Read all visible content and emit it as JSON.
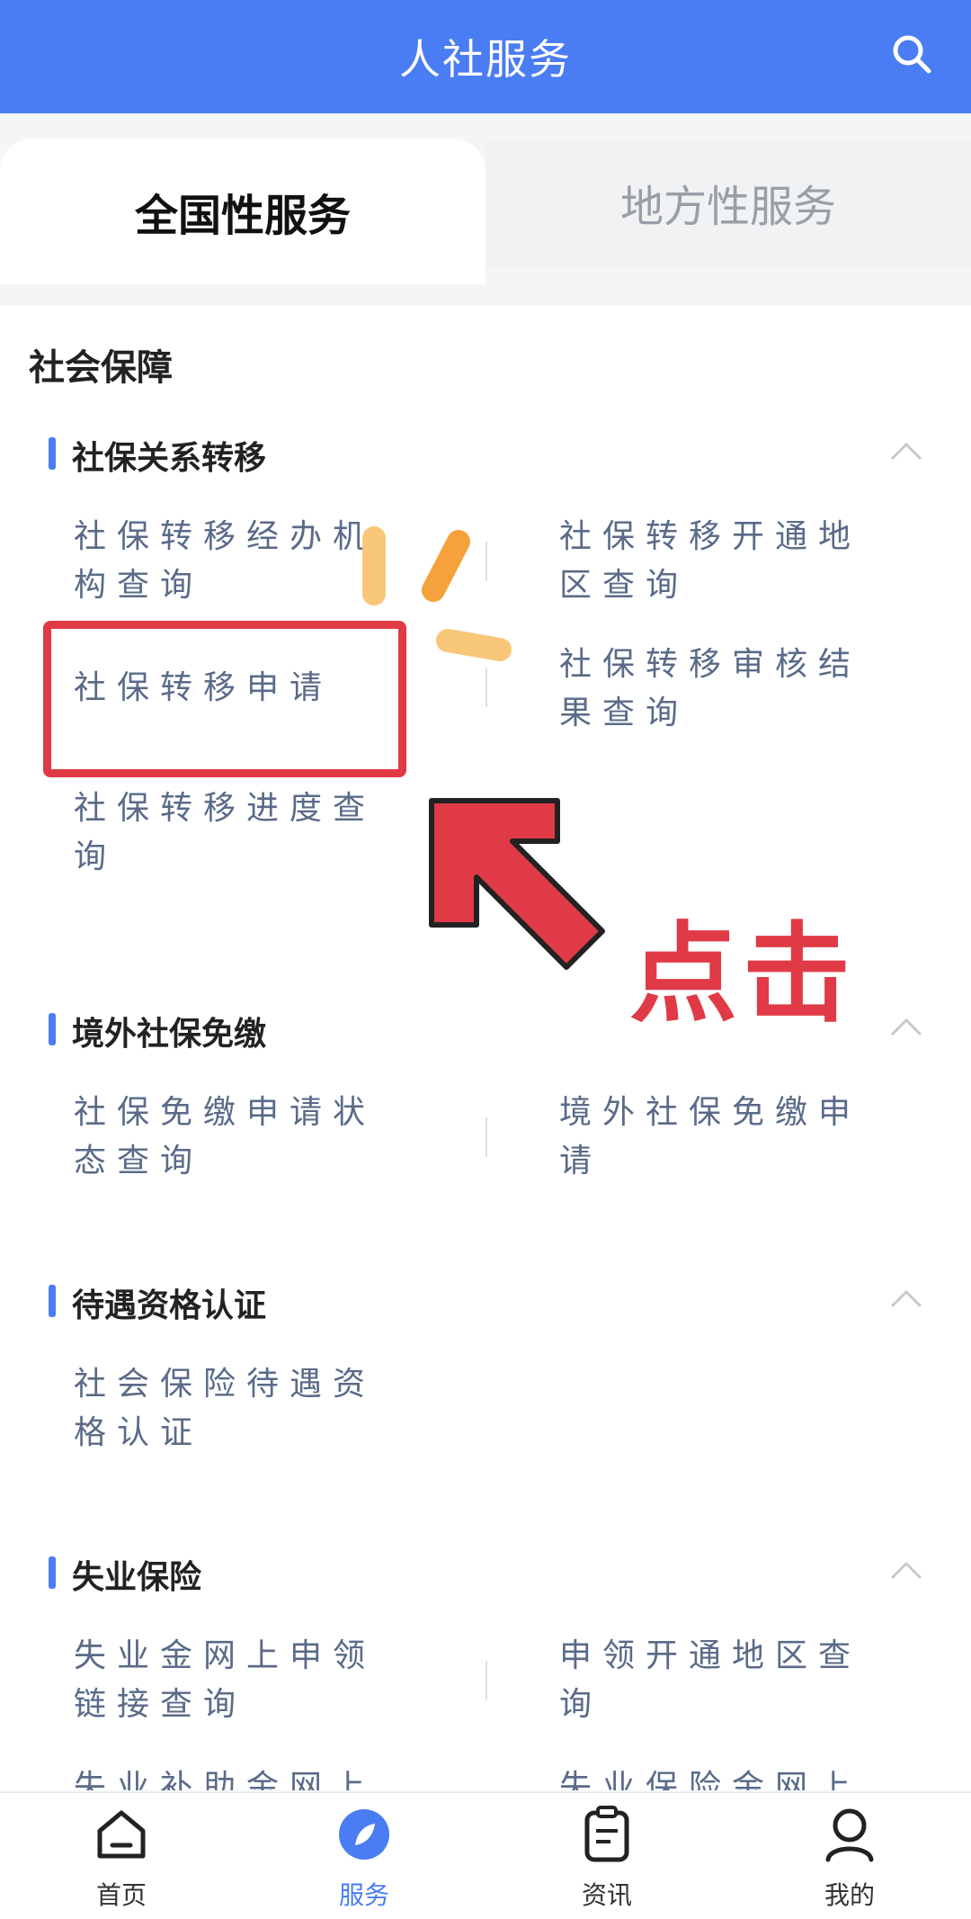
{
  "header": {
    "title": "人社服务"
  },
  "tabs": [
    {
      "label": "全国性服务",
      "active": true
    },
    {
      "label": "地方性服务",
      "active": false
    }
  ],
  "section": {
    "title": "社会保障"
  },
  "groups": [
    {
      "title": "社保关系转移",
      "items": [
        "社保转移经办机构查询",
        "社保转移开通地区查询",
        "社保转移申请",
        "社保转移审核结果查询",
        "社保转移进度查询"
      ]
    },
    {
      "title": "境外社保免缴",
      "items": [
        "社保免缴申请状态查询",
        "境外社保免缴申请"
      ]
    },
    {
      "title": "待遇资格认证",
      "items": [
        "社会保险待遇资格认证"
      ]
    },
    {
      "title": "失业保险",
      "items": [
        "失业金网上申领链接查询",
        "申领开通地区查询",
        "失业补助金网上",
        "失业保险金网上"
      ]
    }
  ],
  "annotation": {
    "text": "点击"
  },
  "bottom_nav": [
    {
      "label": "首页",
      "icon": "home-icon"
    },
    {
      "label": "服务",
      "icon": "compass-icon",
      "active": true
    },
    {
      "label": "资讯",
      "icon": "document-icon"
    },
    {
      "label": "我的",
      "icon": "user-icon"
    }
  ],
  "colors": {
    "primary": "#4a7cf4",
    "annotation": "#e03a46",
    "highlight_sparkle": "#f5a23c"
  }
}
